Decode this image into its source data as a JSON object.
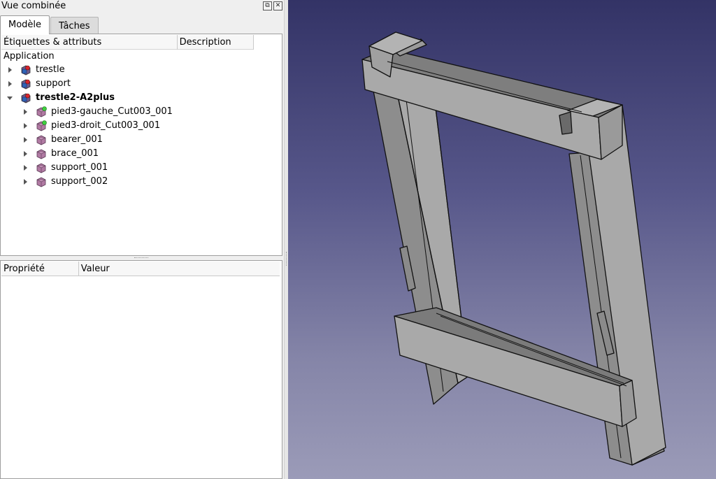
{
  "combo": {
    "title": "Vue combinée",
    "buttons": {
      "float": "⧉",
      "close": "✕"
    },
    "tabs": [
      {
        "label": "Modèle",
        "active": true
      },
      {
        "label": "Tâches",
        "active": false
      }
    ]
  },
  "tree": {
    "columns": [
      "Étiquettes & attributs",
      "Description"
    ],
    "root": "Application",
    "items": [
      {
        "label": "trestle",
        "expanded": false,
        "level": 0,
        "icon": "assembly-icon"
      },
      {
        "label": "support",
        "expanded": false,
        "level": 0,
        "icon": "assembly-icon"
      },
      {
        "label": "trestle2-A2plus",
        "expanded": true,
        "level": 0,
        "bold": true,
        "icon": "assembly-icon"
      },
      {
        "label": "pied3-gauche_Cut003_001",
        "expanded": false,
        "level": 1,
        "icon": "part-icon-updated"
      },
      {
        "label": "pied3-droit_Cut003_001",
        "expanded": false,
        "level": 1,
        "icon": "part-icon-updated"
      },
      {
        "label": "bearer_001",
        "expanded": false,
        "level": 1,
        "icon": "part-icon"
      },
      {
        "label": "brace_001",
        "expanded": false,
        "level": 1,
        "icon": "part-icon"
      },
      {
        "label": "support_001",
        "expanded": false,
        "level": 1,
        "icon": "part-icon"
      },
      {
        "label": "support_002",
        "expanded": false,
        "level": 1,
        "icon": "part-icon"
      }
    ]
  },
  "properties": {
    "columns": [
      "Propriété",
      "Valeur"
    ]
  },
  "view3d": {
    "background_top": "#333366",
    "background_bottom": "#9b9bb8",
    "model_color": "#a9a9a9"
  }
}
